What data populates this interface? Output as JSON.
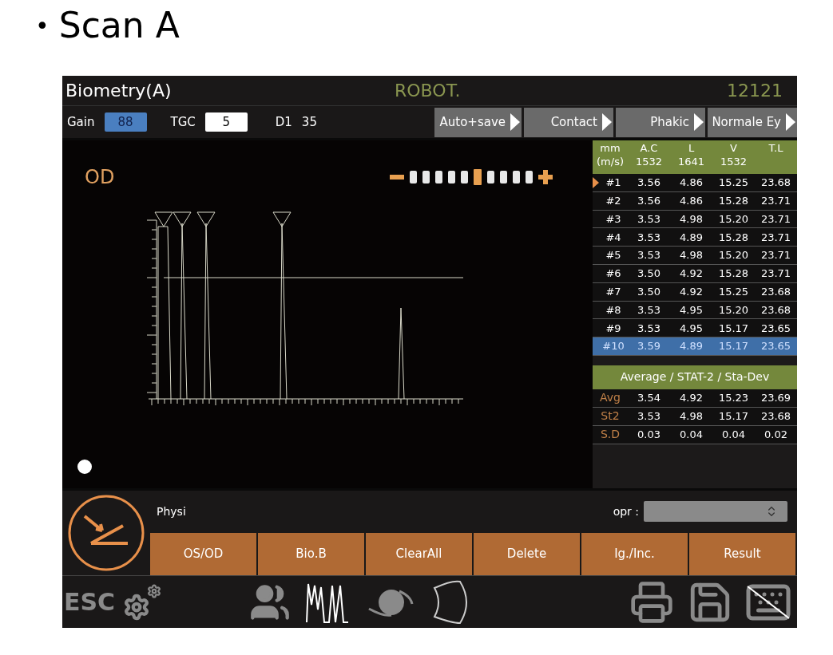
{
  "heading": {
    "bullet": "•",
    "text": "Scan A"
  },
  "header": {
    "title": "Biometry(A)",
    "operator": "ROBOT.",
    "patient_id": "12121"
  },
  "toolbar": {
    "gain": {
      "label": "Gain",
      "value": "88"
    },
    "tgc": {
      "label": "TGC",
      "value": "5"
    },
    "d1": {
      "label": "D1",
      "value": "35"
    },
    "options": [
      "Auto+save",
      "Contact",
      "Phakic",
      "Normale Ey"
    ]
  },
  "scan": {
    "eye": "OD",
    "scale_steps": [
      {
        "selected": false
      },
      {
        "selected": false
      },
      {
        "selected": false
      },
      {
        "selected": false
      },
      {
        "selected": false
      },
      {
        "selected": true
      },
      {
        "selected": false
      },
      {
        "selected": false
      },
      {
        "selected": false
      },
      {
        "selected": false
      }
    ]
  },
  "table": {
    "columns": [
      {
        "name": "mm",
        "speed": "(m/s)"
      },
      {
        "name": "A.C",
        "speed": "1532"
      },
      {
        "name": "L",
        "speed": "1641"
      },
      {
        "name": "V",
        "speed": "1532"
      },
      {
        "name": "T.L"
      }
    ],
    "rows": [
      {
        "cells": [
          "#1",
          "3.56",
          "4.86",
          "15.25",
          "23.68"
        ],
        "selected": false,
        "current": true
      },
      {
        "cells": [
          "#2",
          "3.56",
          "4.86",
          "15.28",
          "23.71"
        ],
        "selected": false,
        "current": false
      },
      {
        "cells": [
          "#3",
          "3.53",
          "4.98",
          "15.20",
          "23.71"
        ],
        "selected": false,
        "current": false
      },
      {
        "cells": [
          "#4",
          "3.53",
          "4.89",
          "15.28",
          "23.71"
        ],
        "selected": false,
        "current": false
      },
      {
        "cells": [
          "#5",
          "3.53",
          "4.98",
          "15.20",
          "23.71"
        ],
        "selected": false,
        "current": false
      },
      {
        "cells": [
          "#6",
          "3.50",
          "4.92",
          "15.28",
          "23.71"
        ],
        "selected": false,
        "current": false
      },
      {
        "cells": [
          "#7",
          "3.50",
          "4.92",
          "15.25",
          "23.68"
        ],
        "selected": false,
        "current": false
      },
      {
        "cells": [
          "#8",
          "3.53",
          "4.95",
          "15.20",
          "23.68"
        ],
        "selected": false,
        "current": false
      },
      {
        "cells": [
          "#9",
          "3.53",
          "4.95",
          "15.17",
          "23.65"
        ],
        "selected": false,
        "current": false
      },
      {
        "cells": [
          "#10",
          "3.59",
          "4.89",
          "15.17",
          "23.65"
        ],
        "selected": true,
        "current": false
      }
    ],
    "stats_title": "Average / STAT-2 / Sta-Dev",
    "stats": [
      {
        "cells": [
          "Avg",
          "3.54",
          "4.92",
          "15.23",
          "23.69"
        ]
      },
      {
        "cells": [
          "St2",
          "3.53",
          "4.98",
          "15.17",
          "23.68"
        ]
      },
      {
        "cells": [
          "S.D",
          "0.03",
          "0.04",
          "0.04",
          "0.02"
        ]
      }
    ]
  },
  "controls": {
    "formula": "Physi",
    "operator_label": "opr :",
    "buttons": [
      "OS/OD",
      "Bio.B",
      "ClearAll",
      "Delete",
      "Ig./Inc.",
      "Result"
    ]
  },
  "bottom_bar": {
    "esc": "ESC"
  }
}
